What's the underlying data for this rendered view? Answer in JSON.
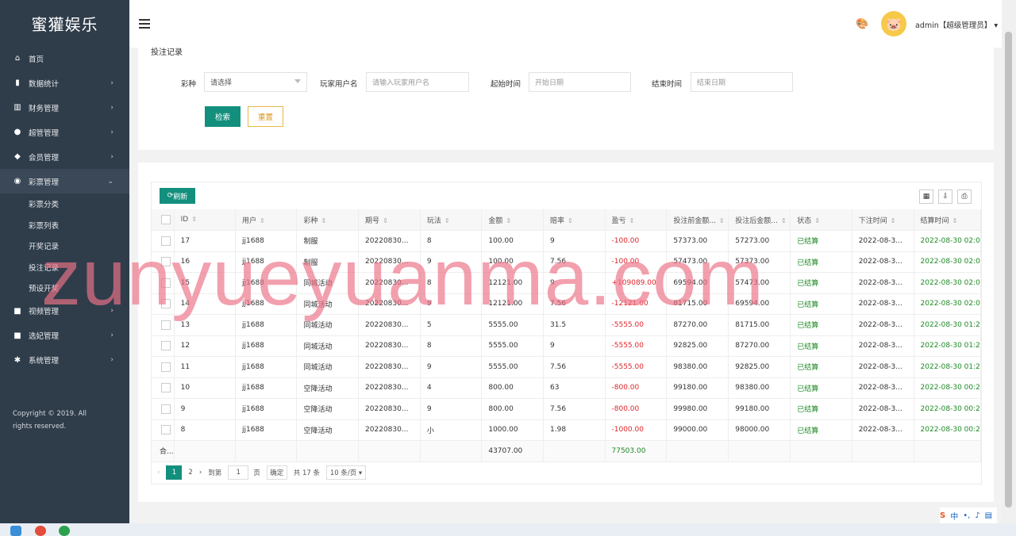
{
  "brand": "蜜獾娱乐",
  "sidebar": {
    "items": [
      {
        "label": "首页",
        "icon": "home-icon",
        "glyph": "⌂",
        "arrow": ""
      },
      {
        "label": "数据统计",
        "icon": "bar-chart-icon",
        "glyph": "▮",
        "arrow": "›"
      },
      {
        "label": "财务管理",
        "icon": "bank-icon",
        "glyph": "▥",
        "arrow": "›"
      },
      {
        "label": "超管管理",
        "icon": "user-icon",
        "glyph": "●",
        "arrow": "›"
      },
      {
        "label": "会员管理",
        "icon": "users-icon",
        "glyph": "◆",
        "arrow": "›"
      },
      {
        "label": "彩票管理",
        "icon": "gamepad-icon",
        "glyph": "◉",
        "arrow": "⌄"
      }
    ],
    "sub_items": [
      "彩票分类",
      "彩票列表",
      "开奖记录",
      "投注记录",
      "预设开奖"
    ],
    "items_after": [
      {
        "label": "视频管理",
        "icon": "video-icon",
        "glyph": "■",
        "arrow": "›"
      },
      {
        "label": "选妃管理",
        "icon": "camera-icon",
        "glyph": "■",
        "arrow": "›"
      },
      {
        "label": "系统管理",
        "icon": "gear-icon",
        "glyph": "✱",
        "arrow": "›"
      }
    ],
    "copyright": "Copyright © 2019. All rights reserved."
  },
  "header": {
    "user": "admin【超级管理员】",
    "user_caret": "▾",
    "palette_glyph": "🎨",
    "avatar_glyph": "🐷"
  },
  "search": {
    "title": "投注记录",
    "lottery_label": "彩种",
    "lottery_value": "请选择",
    "player_label": "玩家用户名",
    "player_placeholder": "请输入玩家用户名",
    "start_label": "起始时间",
    "start_placeholder": "开始日期",
    "end_label": "结束时间",
    "end_placeholder": "结束日期",
    "search_btn": "检索",
    "reset_btn": "重置"
  },
  "table": {
    "refresh_btn": "刷新",
    "columns": [
      "ID",
      "用户",
      "彩种",
      "期号",
      "玩法",
      "金额",
      "赔率",
      "盈亏",
      "投注前金额...",
      "投注后金额...",
      "状态",
      "下注时间",
      "结算时间"
    ],
    "rows": [
      {
        "id": "17",
        "user": "jj1688",
        "lottery": "制服",
        "issue": "20220830...",
        "play": "8",
        "amount": "100.00",
        "odds": "9",
        "profit": "-100.00",
        "before": "57373.00",
        "after": "57273.00",
        "status": "已结算",
        "bet_time": "2022-08-3...",
        "settle_time": "2022-08-30 02:0"
      },
      {
        "id": "16",
        "user": "jj1688",
        "lottery": "制服",
        "issue": "20220830...",
        "play": "9",
        "amount": "100.00",
        "odds": "7.56",
        "profit": "-100.00",
        "before": "57473.00",
        "after": "57373.00",
        "status": "已结算",
        "bet_time": "2022-08-3...",
        "settle_time": "2022-08-30 02:0"
      },
      {
        "id": "15",
        "user": "jj1688",
        "lottery": "同城活动",
        "issue": "20220830...",
        "play": "8",
        "amount": "12121.00",
        "odds": "9",
        "profit": "+109089.00",
        "before": "69594.00",
        "after": "57473.00",
        "status": "已结算",
        "bet_time": "2022-08-3...",
        "settle_time": "2022-08-30 02:0"
      },
      {
        "id": "14",
        "user": "jj1688",
        "lottery": "同城活动",
        "issue": "20220830...",
        "play": "9",
        "amount": "12121.00",
        "odds": "7.56",
        "profit": "-12121.00",
        "before": "81715.00",
        "after": "69594.00",
        "status": "已结算",
        "bet_time": "2022-08-3...",
        "settle_time": "2022-08-30 02:0"
      },
      {
        "id": "13",
        "user": "jj1688",
        "lottery": "同城活动",
        "issue": "20220830...",
        "play": "5",
        "amount": "5555.00",
        "odds": "31.5",
        "profit": "-5555.00",
        "before": "87270.00",
        "after": "81715.00",
        "status": "已结算",
        "bet_time": "2022-08-3...",
        "settle_time": "2022-08-30 01:2"
      },
      {
        "id": "12",
        "user": "jj1688",
        "lottery": "同城活动",
        "issue": "20220830...",
        "play": "8",
        "amount": "5555.00",
        "odds": "9",
        "profit": "-5555.00",
        "before": "92825.00",
        "after": "87270.00",
        "status": "已结算",
        "bet_time": "2022-08-3...",
        "settle_time": "2022-08-30 01:2"
      },
      {
        "id": "11",
        "user": "jj1688",
        "lottery": "同城活动",
        "issue": "20220830...",
        "play": "9",
        "amount": "5555.00",
        "odds": "7.56",
        "profit": "-5555.00",
        "before": "98380.00",
        "after": "92825.00",
        "status": "已结算",
        "bet_time": "2022-08-3...",
        "settle_time": "2022-08-30 01:2"
      },
      {
        "id": "10",
        "user": "jj1688",
        "lottery": "空降活动",
        "issue": "20220830...",
        "play": "4",
        "amount": "800.00",
        "odds": "63",
        "profit": "-800.00",
        "before": "99180.00",
        "after": "98380.00",
        "status": "已结算",
        "bet_time": "2022-08-3...",
        "settle_time": "2022-08-30 00:2"
      },
      {
        "id": "9",
        "user": "jj1688",
        "lottery": "空降活动",
        "issue": "20220830...",
        "play": "9",
        "amount": "800.00",
        "odds": "7.56",
        "profit": "-800.00",
        "before": "99980.00",
        "after": "99180.00",
        "status": "已结算",
        "bet_time": "2022-08-3...",
        "settle_time": "2022-08-30 00:2"
      },
      {
        "id": "8",
        "user": "jj1688",
        "lottery": "空降活动",
        "issue": "20220830...",
        "play": "小",
        "amount": "1000.00",
        "odds": "1.98",
        "profit": "-1000.00",
        "before": "99000.00",
        "after": "98000.00",
        "status": "已结算",
        "bet_time": "2022-08-3...",
        "settle_time": "2022-08-30 00:2"
      }
    ],
    "summary": {
      "label": "合...",
      "amount": "43707.00",
      "profit": "77503.00"
    }
  },
  "pager": {
    "prev": "‹",
    "page1": "1",
    "page2": "2",
    "next": "›",
    "goto_label": "到第",
    "goto_value": "1",
    "page_unit": "页",
    "confirm": "确定",
    "total": "共 17 条",
    "per_page": "10 条/页 ▾"
  },
  "watermark": "zunyueyuanma.com",
  "colors": {
    "accent": "#138f7d",
    "loss": "#e0242a",
    "gain": "#1e8a24",
    "sidebar": "#2f3d4b"
  }
}
